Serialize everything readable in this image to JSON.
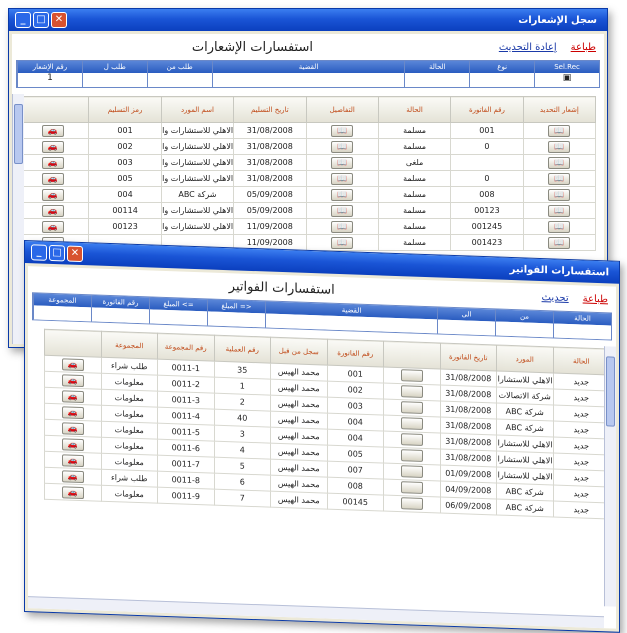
{
  "w1": {
    "title": "سجل الإشعارات",
    "heading": "استفسارات الإشعارات",
    "link1": "طباعة",
    "link2": "إعادة التحديث",
    "filters": [
      {
        "h": "Sel.Rec",
        "v": "▣"
      },
      {
        "h": "نوع",
        "v": ""
      },
      {
        "h": "الحالة",
        "v": ""
      },
      {
        "h": "القضية",
        "v": ""
      },
      {
        "h": "طلب من",
        "v": ""
      },
      {
        "h": "طلب ل",
        "v": ""
      },
      {
        "h": "رقم الإشعار",
        "v": "1"
      }
    ],
    "cols": [
      "إشعار التحديد",
      "رقم الفاتورة",
      "الحالة",
      "التفاصيل",
      "تاريخ التسليم",
      "اسم المورد",
      "رمز التسليم"
    ],
    "rows": [
      [
        "📖",
        "001",
        "مسلمة",
        "📖",
        "31/08/2008",
        "الاهلي للاستشارات والبرمجة",
        "001",
        "🚗"
      ],
      [
        "📖",
        "0",
        "مسلمة",
        "📖",
        "31/08/2008",
        "الاهلي للاستشارات والبرمجة",
        "002",
        "🚗"
      ],
      [
        "📖",
        "",
        "ملغى",
        "📖",
        "31/08/2008",
        "الاهلي للاستشارات والبرمجة",
        "003",
        "🚗"
      ],
      [
        "📖",
        "0",
        "مسلمة",
        "📖",
        "31/08/2008",
        "الاهلي للاستشارات والبرمجة",
        "005",
        "🚗"
      ],
      [
        "📖",
        "008",
        "مسلمة",
        "📖",
        "05/09/2008",
        "شركة ABC",
        "004",
        "🚗"
      ],
      [
        "📖",
        "00123",
        "مسلمة",
        "📖",
        "05/09/2008",
        "الاهلي للاستشارات والبرمجة",
        "00114",
        "🚗"
      ],
      [
        "📖",
        "001245",
        "مسلمة",
        "📖",
        "11/09/2008",
        "الاهلي للاستشارات والبرمجة",
        "00123",
        "🚗"
      ],
      [
        "📖",
        "001423",
        "مسلمة",
        "📖",
        "11/09/2008",
        "",
        "",
        "🚗"
      ]
    ]
  },
  "w2": {
    "title": "استفسارات الفواتير",
    "heading": "استفسارات الفواتير",
    "link1": "طباعة",
    "link2": "تحديث",
    "filters": [
      {
        "h": "الحالة",
        "v": ""
      },
      {
        "h": "من",
        "v": ""
      },
      {
        "h": "الى",
        "v": ""
      },
      {
        "h": "القضية",
        "v": ""
      },
      {
        "h": "<= المبلغ",
        "v": ""
      },
      {
        "h": "=> المبلغ",
        "v": ""
      },
      {
        "h": "رقم الفاتورة",
        "v": ""
      },
      {
        "h": "المجموعة",
        "v": ""
      }
    ],
    "cols": [
      "الحالة",
      "المورد",
      "تاريخ الفاتورة",
      "",
      "رقم الفاتورة",
      "سجل من قبل",
      "رقم العملية",
      "رقم المجموعة",
      "المجموعة",
      ""
    ],
    "rows": [
      [
        "جديد",
        "الاهلي للاستشارات والبرمجة",
        "31/08/2008",
        "",
        "001",
        "محمد الهيس",
        "35",
        "0011-1",
        "طلب شراء",
        "🚗"
      ],
      [
        "جديد",
        "شركة الاتصالات",
        "31/08/2008",
        "",
        "002",
        "محمد الهيس",
        "1",
        "0011-2",
        "معلومات",
        "🚗"
      ],
      [
        "جديد",
        "شركة ABC",
        "31/08/2008",
        "",
        "003",
        "محمد الهيس",
        "2",
        "0011-3",
        "معلومات",
        "🚗"
      ],
      [
        "جديد",
        "شركة ABC",
        "31/08/2008",
        "",
        "004",
        "محمد الهيس",
        "40",
        "0011-4",
        "معلومات",
        "🚗"
      ],
      [
        "جديد",
        "الاهلي للاستشارات والبرمجة",
        "31/08/2008",
        "",
        "004",
        "محمد الهيس",
        "3",
        "0011-5",
        "معلومات",
        "🚗"
      ],
      [
        "جديد",
        "الاهلي للاستشارات والبرمجة",
        "31/08/2008",
        "",
        "005",
        "محمد الهيس",
        "4",
        "0011-6",
        "معلومات",
        "🚗"
      ],
      [
        "جديد",
        "الاهلي للاستشارات والبرمجة",
        "01/09/2008",
        "",
        "007",
        "محمد الهيس",
        "5",
        "0011-7",
        "معلومات",
        "🚗"
      ],
      [
        "جديد",
        "شركة ABC",
        "04/09/2008",
        "",
        "008",
        "محمد الهيس",
        "6",
        "0011-8",
        "طلب شراء",
        "🚗"
      ],
      [
        "جديد",
        "شركة ABC",
        "06/09/2008",
        "",
        "00145",
        "محمد الهيس",
        "7",
        "0011-9",
        "معلومات",
        "🚗"
      ]
    ]
  }
}
